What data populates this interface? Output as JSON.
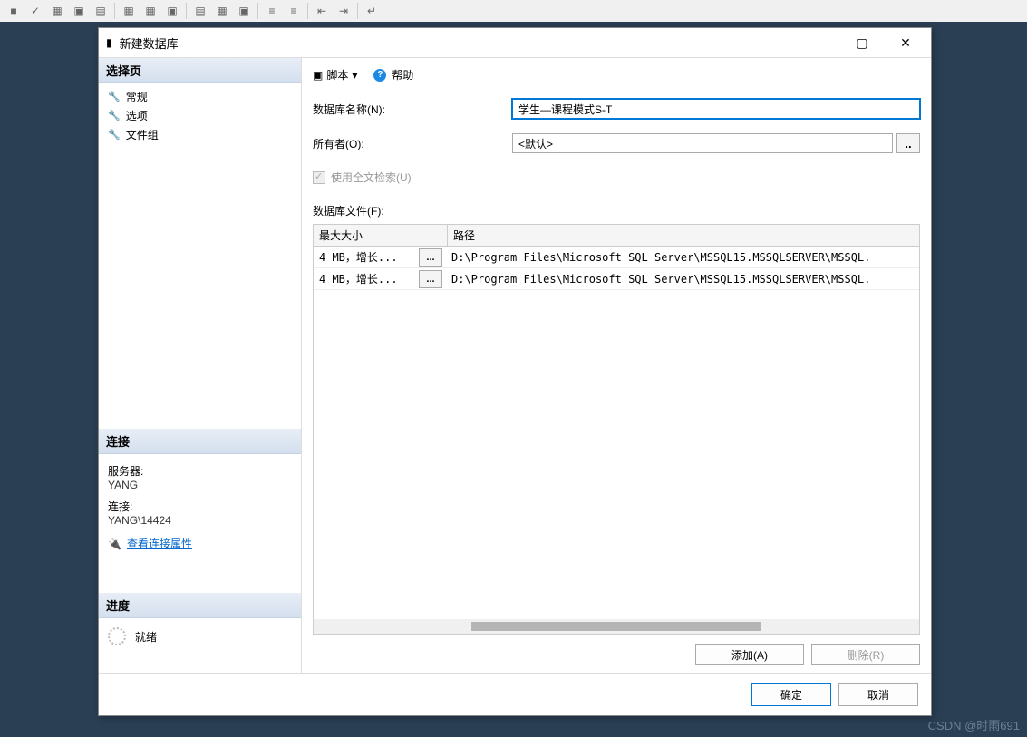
{
  "dialog": {
    "title": "新建数据库",
    "win_buttons": {
      "min": "—",
      "max": "▢",
      "close": "✕"
    }
  },
  "sidebar": {
    "select_page": "选择页",
    "items": [
      {
        "icon": "wrench-icon",
        "label": "常规"
      },
      {
        "icon": "wrench-icon",
        "label": "选项"
      },
      {
        "icon": "wrench-icon",
        "label": "文件组"
      }
    ],
    "connection_header": "连接",
    "server_label": "服务器:",
    "server_value": "YANG",
    "conn_label": "连接:",
    "conn_value": "YANG\\14424",
    "conn_link": "查看连接属性",
    "progress_header": "进度",
    "progress_status": "就绪"
  },
  "main": {
    "script_label": "脚本",
    "help_label": "帮助",
    "db_name_label": "数据库名称(N):",
    "db_name_value": "学生—课程模式S-T",
    "owner_label": "所有者(O):",
    "owner_value": "<默认>",
    "fulltext_label": "使用全文检索(U)",
    "files_label": "数据库文件(F):",
    "grid": {
      "columns": [
        {
          "label": "最大大小",
          "width": 118
        },
        {
          "label": "路径",
          "width": 0
        }
      ],
      "rows": [
        {
          "size": "4 MB，增长...",
          "path": "D:\\Program Files\\Microsoft SQL Server\\MSSQL15.MSSQLSERVER\\MSSQL."
        },
        {
          "size": "4 MB，增长...",
          "path": "D:\\Program Files\\Microsoft SQL Server\\MSSQL15.MSSQLSERVER\\MSSQL."
        }
      ]
    },
    "add_btn": "添加(A)",
    "remove_btn": "删除(R)"
  },
  "footer": {
    "ok": "确定",
    "cancel": "取消"
  },
  "watermark": "CSDN @时雨691"
}
